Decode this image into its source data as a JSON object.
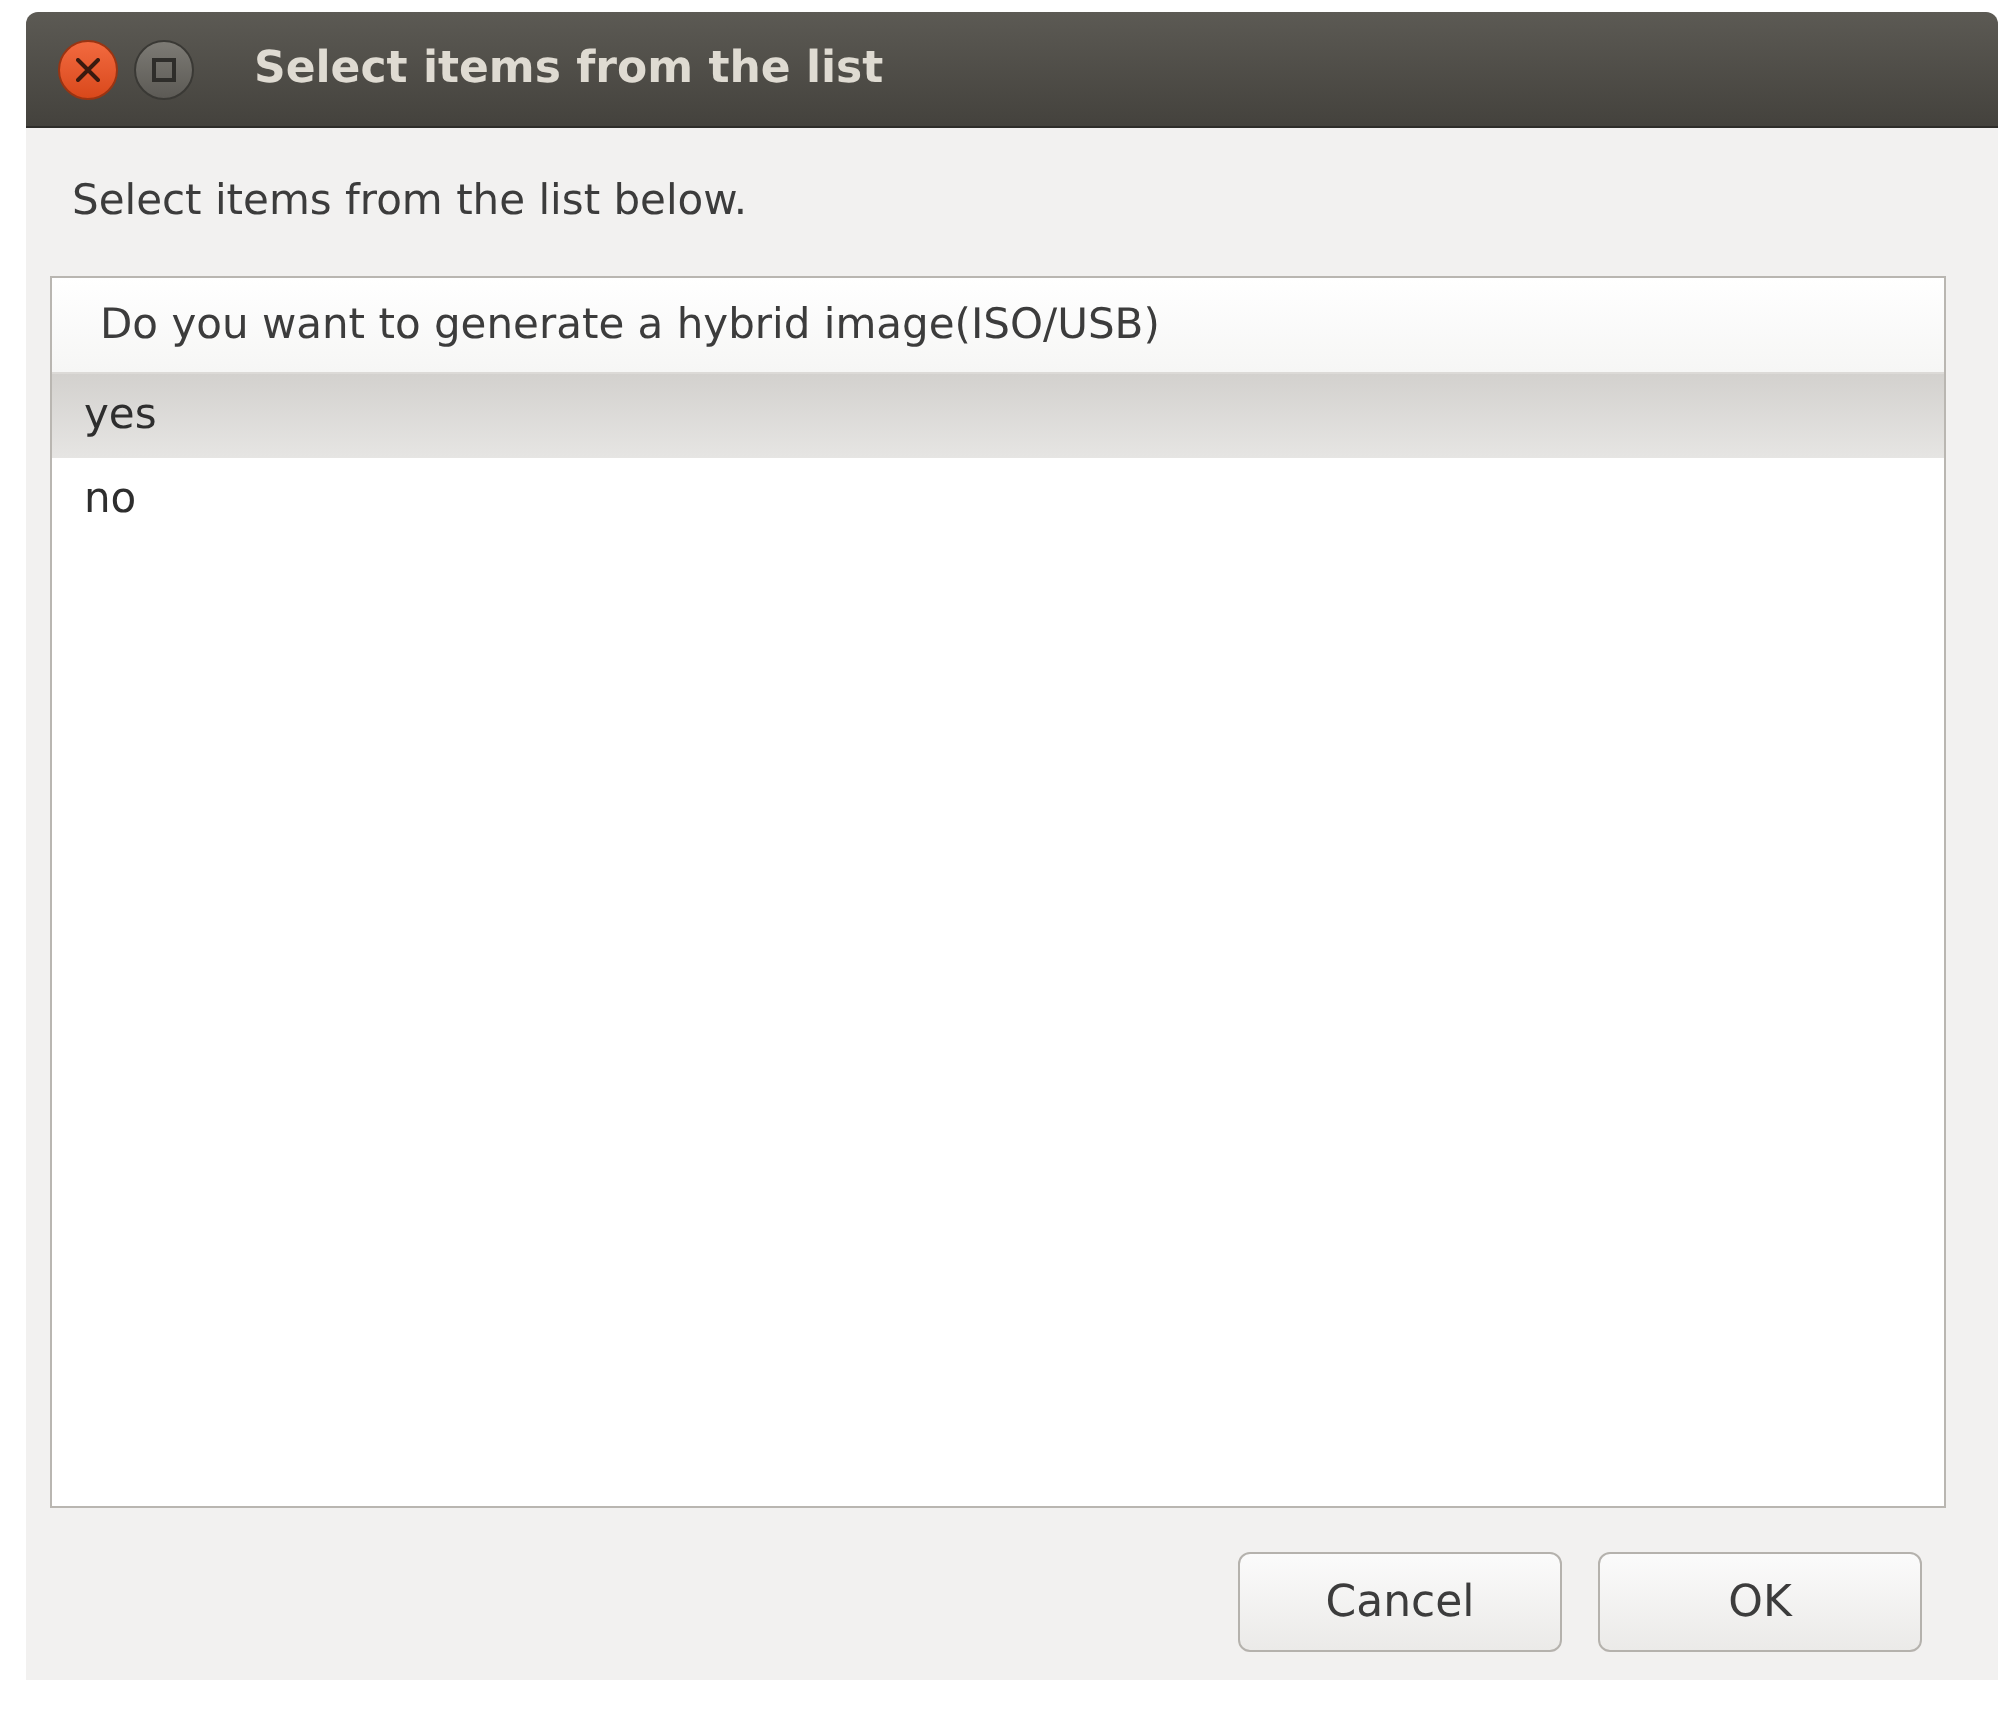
{
  "window": {
    "title": "Select items from the list"
  },
  "prompt": "Select items from the list below.",
  "list": {
    "column": "Do you want to generate a hybrid image(ISO/USB)",
    "rows": [
      {
        "label": "yes",
        "selected": true
      },
      {
        "label": "no",
        "selected": false
      }
    ]
  },
  "buttons": [
    "Cancel",
    "OK"
  ]
}
